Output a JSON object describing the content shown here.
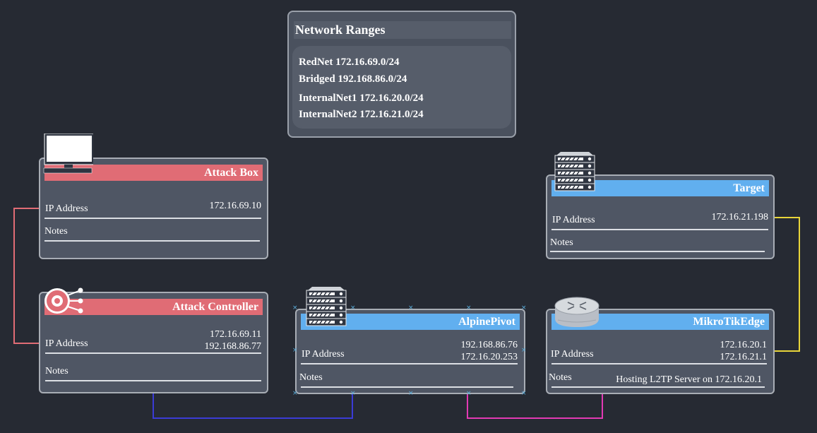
{
  "network_ranges": {
    "title": "Network Ranges",
    "lines": [
      "RedNet 172.16.69.0/24",
      "Bridged 192.168.86.0/24",
      "InternalNet1 172.16.20.0/24",
      "InternalNet2 172.16.21.0/24"
    ]
  },
  "labels": {
    "ip": "IP Address",
    "notes": "Notes"
  },
  "nodes": {
    "attack_box": {
      "title": "Attack Box",
      "ip": [
        "172.16.69.10"
      ],
      "notes": ""
    },
    "attack_controller": {
      "title": "Attack Controller",
      "ip": [
        "172.16.69.11",
        "192.168.86.77"
      ],
      "notes": ""
    },
    "alpine_pivot": {
      "title": "AlpinePivot",
      "ip": [
        "192.168.86.76",
        "172.16.20.253"
      ],
      "notes": ""
    },
    "mikrotik_edge": {
      "title": "MikroTikEdge",
      "ip": [
        "172.16.20.1",
        "172.16.21.1"
      ],
      "notes": "Hosting L2TP Server on 172.16.20.1"
    },
    "target": {
      "title": "Target",
      "ip": [
        "172.16.21.198"
      ],
      "notes": ""
    }
  },
  "icons": {
    "attack_box": "monitor-icon",
    "attack_controller": "controller-hub-icon",
    "alpine_pivot": "server-rack-icon",
    "mikrotik_edge": "router-icon",
    "target": "server-rack-icon"
  },
  "colors": {
    "background": "#262a33",
    "attacker_header": "#e06c75",
    "host_header": "#61afef",
    "link_rednet": "#e06c75",
    "link_bridged": "#3b3bd6",
    "link_internal1": "#e23ab4",
    "link_internal2": "#e8d53a"
  }
}
